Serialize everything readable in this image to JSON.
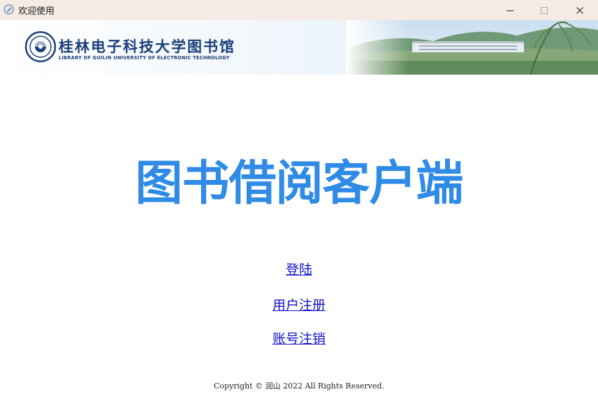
{
  "window": {
    "title": "欢迎使用",
    "icon": "app-icon"
  },
  "banner": {
    "logo_text_zh": "桂林电子科技大学图书馆",
    "logo_text_en": "LIBRARY OF GUILIN UNIVERSITY OF ELECTRONIC TECHNOLOGY",
    "emblem": "university-emblem-icon",
    "colors": {
      "brand": "#1b3f7a"
    }
  },
  "main": {
    "headline": "图书借阅客户端",
    "headline_color": "#2f8be6"
  },
  "links": {
    "login": "登陆",
    "register": "用户注册",
    "cancel_account": "账号注销",
    "color": "#1414c8"
  },
  "footer": {
    "copyright": "Copyright © 润山 2022 All Rights Reserved."
  }
}
